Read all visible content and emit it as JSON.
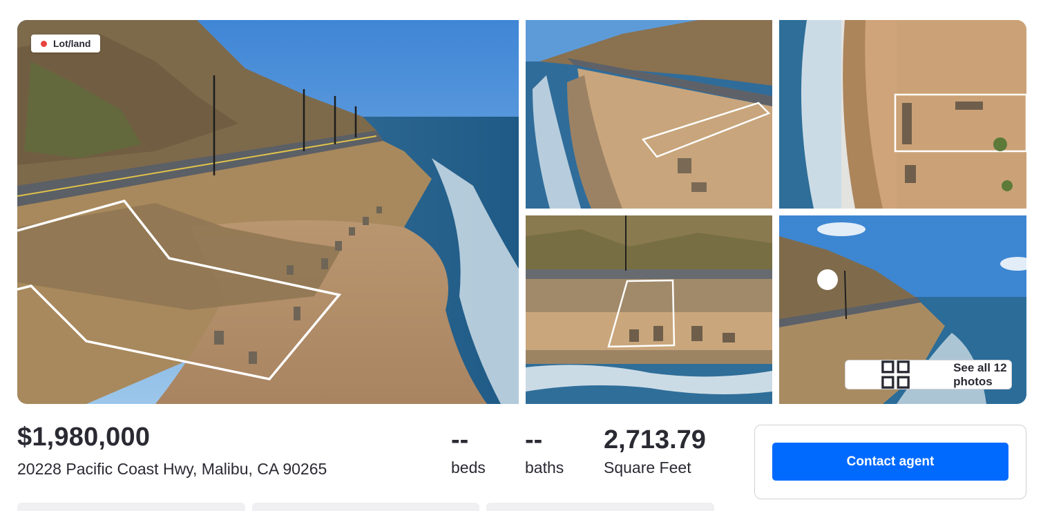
{
  "listing": {
    "type_badge": "Lot/land",
    "see_all_label": "See all 12 photos",
    "price": "$1,980,000",
    "address": "20228 Pacific Coast Hwy, Malibu, CA 90265"
  },
  "stats": {
    "beds_value": "--",
    "beds_label": "beds",
    "baths_value": "--",
    "baths_label": "baths",
    "sqft_value": "2,713.79",
    "sqft_label": "Square Feet"
  },
  "contact": {
    "button_label": "Contact agent"
  },
  "colors": {
    "accent": "#006aff",
    "badge_dot": "#e8433f",
    "text": "#2a2a33",
    "sky": "#4a90d9",
    "ocean": "#2d6fa3",
    "sand": "#c9a37a",
    "cliff": "#8a7150"
  },
  "icons": {
    "badge": "red-dot-icon",
    "see_all": "grid-icon"
  }
}
